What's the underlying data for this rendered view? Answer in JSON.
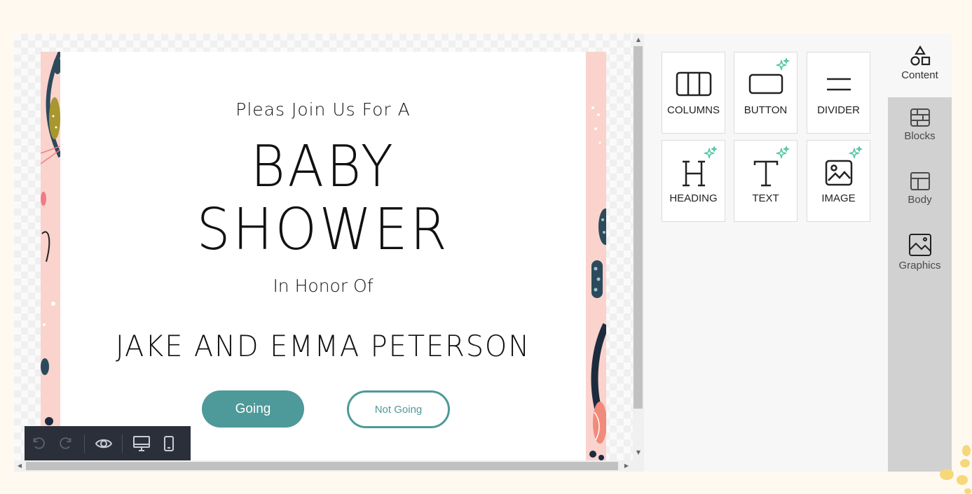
{
  "invite": {
    "intro": "Pleas Join Us For A",
    "title_line1": "BABY",
    "title_line2": "SHOWER",
    "honor": "In Honor Of",
    "names": "JAKE AND EMMA PETERSON",
    "going_label": "Going",
    "not_going_label": "Not Going",
    "accent_color": "#4e9999",
    "background_color": "#f9d3cc"
  },
  "toolbar": {
    "undo_icon": "undo-icon",
    "redo_icon": "redo-icon",
    "preview_icon": "eye-icon",
    "desktop_icon": "desktop-icon",
    "mobile_icon": "mobile-icon"
  },
  "tools": {
    "tiles": [
      {
        "label": "COLUMNS",
        "icon": "columns-icon",
        "ai": false
      },
      {
        "label": "BUTTON",
        "icon": "button-icon",
        "ai": true
      },
      {
        "label": "DIVIDER",
        "icon": "divider-icon",
        "ai": false
      },
      {
        "label": "HEADING",
        "icon": "heading-icon",
        "ai": true
      },
      {
        "label": "TEXT",
        "icon": "text-icon",
        "ai": true
      },
      {
        "label": "IMAGE",
        "icon": "image-icon",
        "ai": true
      }
    ],
    "sparkle_color": "#3fbf9a"
  },
  "sidenav": {
    "items": [
      {
        "label": "Content",
        "icon": "shapes-icon",
        "active": true
      },
      {
        "label": "Blocks",
        "icon": "blocks-icon",
        "active": false
      },
      {
        "label": "Body",
        "icon": "layout-icon",
        "active": false
      },
      {
        "label": "Graphics",
        "icon": "picture-icon",
        "active": false
      }
    ]
  }
}
